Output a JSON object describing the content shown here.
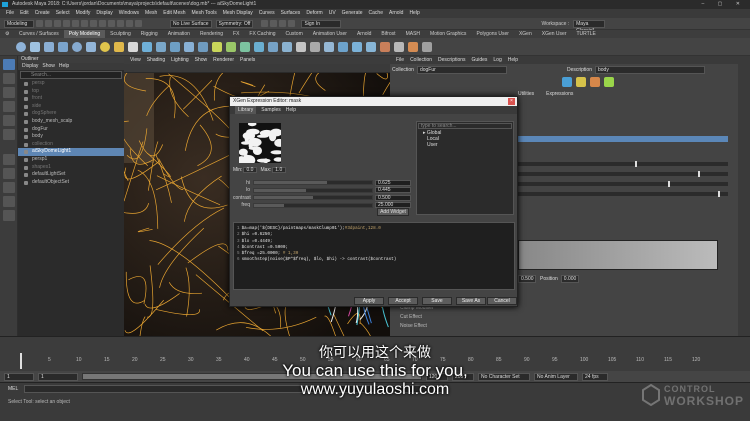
{
  "window": {
    "title": "Autodesk Maya 2018: C:\\Users\\jordan\\Documents\\maya\\projects\\default\\scenes\\dog.mb* --- aiSkyDomeLight1",
    "controls": "–  ▢  ✕"
  },
  "menubar": [
    "File",
    "Edit",
    "Create",
    "Select",
    "Modify",
    "Display",
    "Windows",
    "Mesh",
    "Edit Mesh",
    "Mesh Tools",
    "Mesh Display",
    "Curves",
    "Surfaces",
    "Deform",
    "UV",
    "Generate",
    "Cache",
    "Arnold",
    "Help"
  ],
  "statusline": {
    "mode": "Modeling",
    "live_surface": "No Live Surface",
    "symmetry": "Symmetry: Off",
    "sign_in": "Sign In",
    "workspace_label": "Workspace :",
    "workspace": "Maya Classic*"
  },
  "shelf_tabs": [
    "Curves / Surfaces",
    "Poly Modeling",
    "Sculpting",
    "Rigging",
    "Animation",
    "Rendering",
    "FX",
    "FX Caching",
    "Custom",
    "Animation User",
    "Arnold",
    "Bifrost",
    "MASH",
    "Motion Graphics",
    "Polygons User",
    "XGen",
    "XGen User",
    "TURTLE"
  ],
  "shelf_active": "Poly Modeling",
  "outliner": {
    "title": "Outliner",
    "menus": [
      "Display",
      "Show",
      "Help"
    ],
    "search_placeholder": "Search...",
    "items": [
      {
        "label": "persp",
        "dim": true
      },
      {
        "label": "top",
        "dim": true
      },
      {
        "label": "front",
        "dim": true
      },
      {
        "label": "side",
        "dim": true
      },
      {
        "label": "dogSphere",
        "dim": true
      },
      {
        "label": "body_mesh_scalp",
        "dim": false
      },
      {
        "label": "dogFur",
        "dim": false
      },
      {
        "label": "body",
        "dim": false
      },
      {
        "label": "collection",
        "dim": true
      },
      {
        "label": "aiSkyDomeLight1",
        "dim": false,
        "selected": true
      },
      {
        "label": "persp1",
        "dim": false
      },
      {
        "label": "shapes1",
        "dim": true
      },
      {
        "label": "defaultLightSet",
        "dim": false
      },
      {
        "label": "defaultObjectSet",
        "dim": false
      }
    ]
  },
  "viewport": {
    "menus": [
      "View",
      "Shading",
      "Lighting",
      "Show",
      "Renderer",
      "Panels"
    ]
  },
  "xgen": {
    "menus": [
      "File",
      "Collection",
      "Descriptions",
      "Guides",
      "Log",
      "Help"
    ],
    "collection_label": "Collection",
    "collection_value": "dogFur",
    "description_label": "Description",
    "description_value": "body",
    "tabs": [
      "Utilities",
      "Expressions"
    ],
    "effects": [
      "Clump Modifier",
      "Cut Effect",
      "Noise Effect",
      "Coil Effect"
    ],
    "position_label": "Position",
    "position_value": "0.000",
    "pos_left_value": "0.500"
  },
  "editor": {
    "title": "XGen Expression Editor: mask",
    "close": "×",
    "tabs": [
      "Library",
      "Samples",
      "Help"
    ],
    "search_placeholder": "type to search...",
    "library_tree": [
      "Global",
      "Local",
      "User"
    ],
    "min_label": "Min:",
    "min_value": "0.0",
    "max_label": "Max:",
    "max_value": "1.0",
    "sliders": [
      {
        "label": "hi",
        "value": "0.625",
        "fill": 0.62
      },
      {
        "label": "lo",
        "value": "0.445",
        "fill": 0.44
      },
      {
        "label": "contrast",
        "value": "0.500",
        "fill": 0.5
      },
      {
        "label": "freq",
        "value": "25.000",
        "fill": 0.25
      }
    ],
    "add_widget": "Add Widget",
    "code": [
      {
        "n": "1",
        "pre": "$a=map('${DESC}/paintmaps/maskClump01');",
        "str": "#3dpaint,128.0"
      },
      {
        "n": "2",
        "pre": "$hi =0.6250;",
        "str": ""
      },
      {
        "n": "3",
        "pre": "$lo =0.4449;",
        "str": ""
      },
      {
        "n": "4",
        "pre": "$contrast =0.5000;",
        "str": ""
      },
      {
        "n": "5",
        "pre": "$freq =25.0000; ",
        "str": "# 1,30"
      },
      {
        "n": "6",
        "pre": "smoothstep(noise($P*$freq), $lo, $hi) -> contrast($contrast)",
        "str": ""
      }
    ],
    "buttons": [
      "Apply",
      "Accept",
      "Save",
      "Save As",
      "Cancel"
    ]
  },
  "timeline": {
    "ticks": [
      "5",
      "10",
      "15",
      "20",
      "25",
      "30",
      "35",
      "40",
      "45",
      "50",
      "55",
      "60",
      "65",
      "70",
      "75",
      "80",
      "85",
      "90",
      "95",
      "100",
      "105",
      "110",
      "115",
      "120"
    ],
    "current_frame": "1",
    "range_start": "1",
    "range_start2": "1",
    "range_end": "120",
    "range_end2": "200",
    "character_set": "No Character Set",
    "anim_layer": "No Anim Layer",
    "fps": "24 fps"
  },
  "mel_label": "MEL",
  "help_line": "Select Tool: select an object",
  "subtitles": {
    "chinese": "你可以用这个来做",
    "english": "You can use this for you,",
    "url": "www.yuyulaoshi.com"
  },
  "watermark": {
    "top": "CONTROL",
    "bottom": "WORKSHOP"
  },
  "colors": {
    "selection": "#5e86b4",
    "maya_logo": "#1ea2d9",
    "fur_orange": "#e7a431"
  }
}
